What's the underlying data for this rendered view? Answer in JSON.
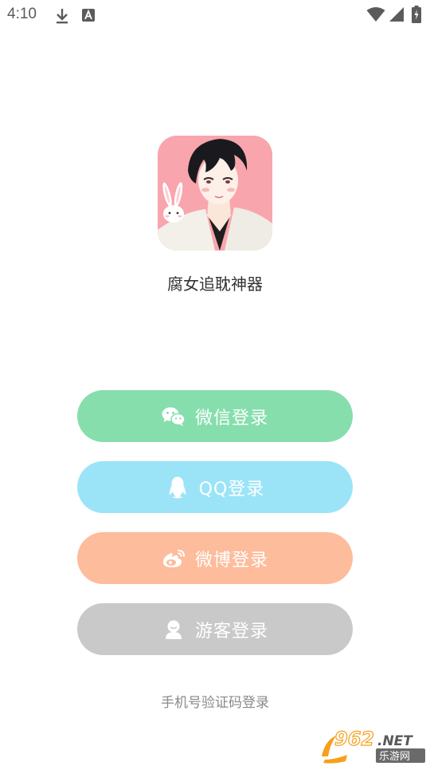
{
  "status_bar": {
    "time": "4:10",
    "icons": [
      "download-icon",
      "a-notification-icon",
      "wifi-icon",
      "signal-icon",
      "battery-icon"
    ]
  },
  "app": {
    "name": "腐女追耽神器",
    "icon": "app-logo-anime-boy-with-bunny"
  },
  "login_buttons": [
    {
      "label": "微信登录",
      "icon": "wechat-icon",
      "color": "#86dead"
    },
    {
      "label": "QQ登录",
      "icon": "qq-penguin-icon",
      "color": "#9be4f7"
    },
    {
      "label": "微博登录",
      "icon": "weibo-icon",
      "color": "#fdbc9b"
    },
    {
      "label": "游客登录",
      "icon": "guest-user-icon",
      "color": "#c9c9c9"
    }
  ],
  "phone_login": {
    "label": "手机号验证码登录"
  },
  "watermark": {
    "text_top": "962.NET",
    "text_bottom": "乐游网"
  }
}
